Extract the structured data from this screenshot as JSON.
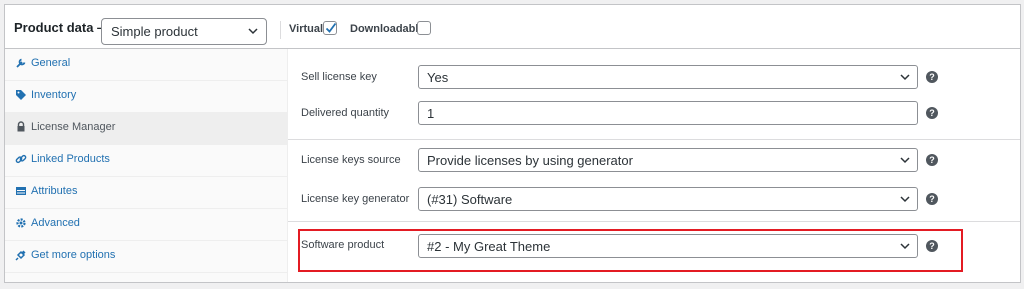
{
  "header": {
    "title": "Product data —",
    "product_type": "Simple product",
    "virtual_label": "Virtual:",
    "virtual_checked": true,
    "downloadable_label": "Downloadable:",
    "downloadable_checked": false
  },
  "sidebar": {
    "items": [
      {
        "label": "General",
        "icon": "wrench-icon",
        "active": false
      },
      {
        "label": "Inventory",
        "icon": "tag-icon",
        "active": false
      },
      {
        "label": "License Manager",
        "icon": "lock-icon",
        "active": true
      },
      {
        "label": "Linked Products",
        "icon": "link-icon",
        "active": false
      },
      {
        "label": "Attributes",
        "icon": "table-icon",
        "active": false
      },
      {
        "label": "Advanced",
        "icon": "gear-icon",
        "active": false
      },
      {
        "label": "Get more options",
        "icon": "plugin-icon",
        "active": false
      }
    ]
  },
  "fields": {
    "sell_license_key": {
      "label": "Sell license key",
      "value": "Yes"
    },
    "delivered_quantity": {
      "label": "Delivered quantity",
      "value": "1"
    },
    "license_keys_source": {
      "label": "License keys source",
      "value": "Provide licenses by using generator"
    },
    "license_key_generator": {
      "label": "License key generator",
      "value": "(#31) Software"
    },
    "software_product": {
      "label": "Software product",
      "value": "#2 - My Great Theme"
    }
  },
  "colors": {
    "link": "#2271b1",
    "highlight": "#e31b23",
    "border": "#8c8f94"
  }
}
